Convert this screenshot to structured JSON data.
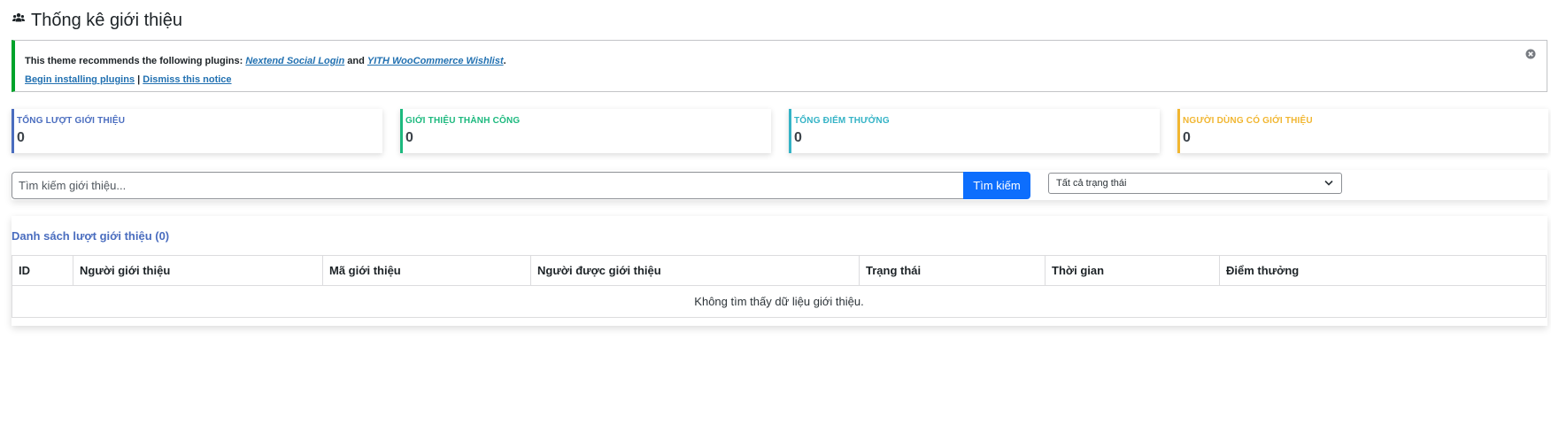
{
  "header": {
    "title": "Thống kê giới thiệu",
    "icon": "users-icon"
  },
  "notice": {
    "prefix": "This theme recommends the following plugins: ",
    "plugin1": "Nextend Social Login",
    "and": " and ",
    "plugin2": "YITH WooCommerce Wishlist",
    "suffix": ".",
    "install_link": "Begin installing plugins",
    "separator": " | ",
    "dismiss_link": "Dismiss this notice",
    "accent": "#00a32a"
  },
  "stats": [
    {
      "label": "TỔNG LƯỢT GIỚI THIỆU",
      "value": "0",
      "color": "#4a6dbf"
    },
    {
      "label": "GIỚI THIỆU THÀNH CÔNG",
      "value": "0",
      "color": "#1cb97e"
    },
    {
      "label": "TỔNG ĐIỂM THƯỞNG",
      "value": "0",
      "color": "#34b3c6"
    },
    {
      "label": "NGƯỜI DÙNG CÓ GIỚI THIỆU",
      "value": "0",
      "color": "#f1b631"
    }
  ],
  "search": {
    "placeholder": "Tìm kiếm giới thiệu...",
    "value": "",
    "button_label": "Tìm kiếm",
    "button_color": "#0d6efd",
    "status_selected": "Tất cả trạng thái"
  },
  "list": {
    "title": "Danh sách lượt giới thiệu (0)",
    "columns": [
      "ID",
      "Người giới thiệu",
      "Mã giới thiệu",
      "Người được giới thiệu",
      "Trạng thái",
      "Thời gian",
      "Điểm thưởng"
    ],
    "empty_message": "Không tìm thấy dữ liệu giới thiệu."
  }
}
